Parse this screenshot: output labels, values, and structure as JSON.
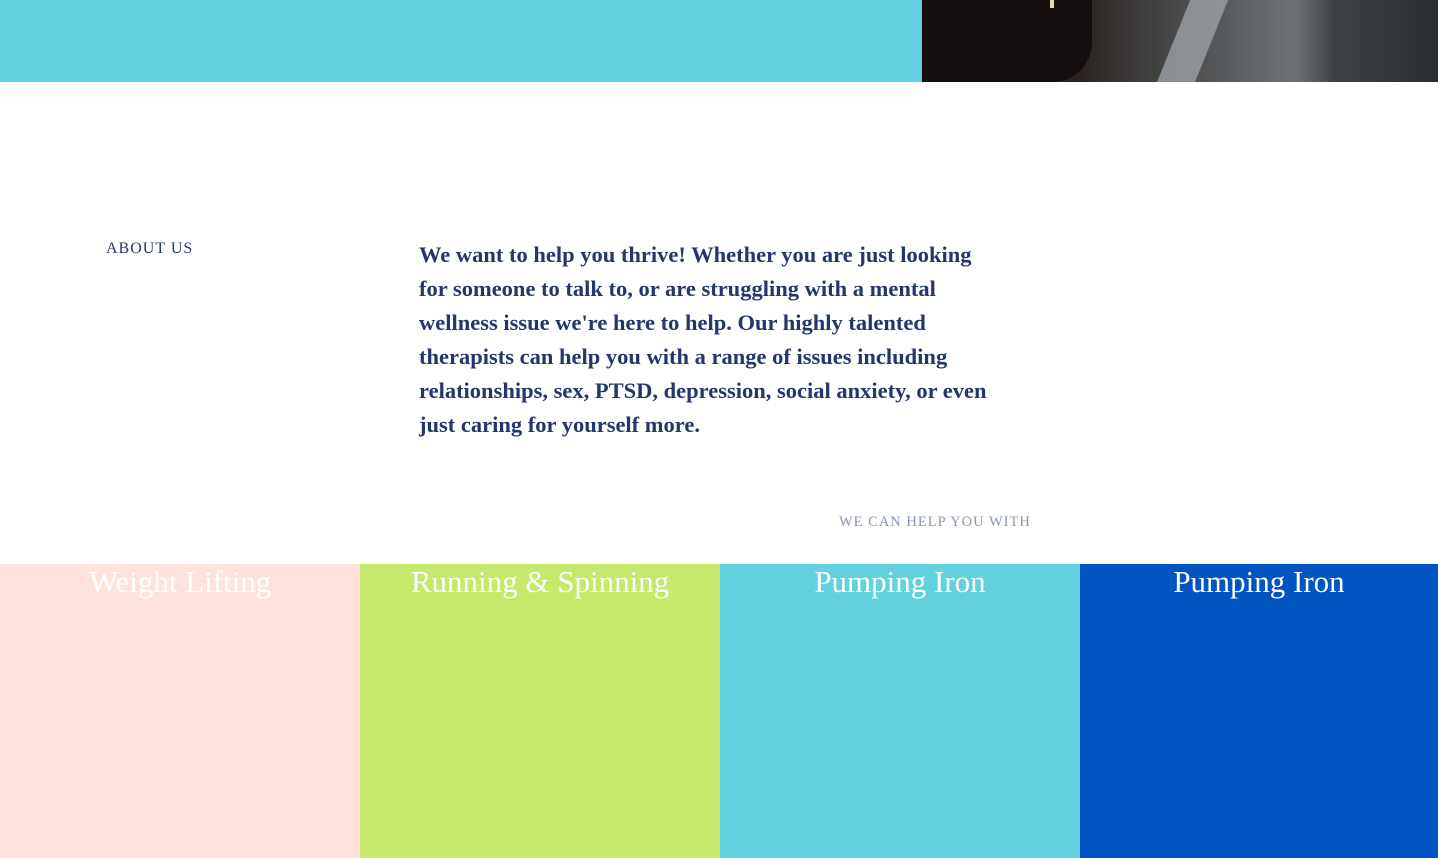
{
  "hero": {
    "band_color": "#62d0de"
  },
  "about": {
    "label": "ABOUT US",
    "text": "We want to help you thrive! Whether you are just looking for someone to talk to, or are struggling with a mental wellness issue we're here to help. Our highly talented therapists can help you with a range of issues including relationships, sex, PTSD, depression, social anxiety, or even just caring for yourself more.",
    "text_color": "#24366b"
  },
  "services": {
    "label": "WE CAN HELP YOU WITH",
    "cards": [
      {
        "title": "Weight Lifting",
        "color": "#ffe1dd"
      },
      {
        "title": "Running & Spinning",
        "color": "#c6e86b"
      },
      {
        "title": "Pumping Iron",
        "color": "#62d0de"
      },
      {
        "title": "Pumping Iron",
        "color": "#0254c0"
      }
    ]
  }
}
